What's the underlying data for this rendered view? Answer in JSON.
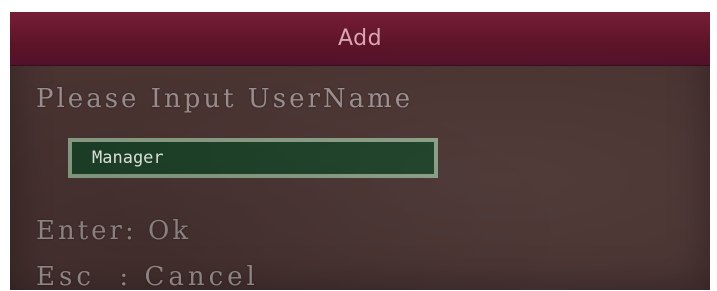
{
  "dialog": {
    "title": "Add",
    "prompt": "Please Input UserName",
    "username_value": "Manager",
    "enter_hint": "Enter: Ok",
    "esc_hint": "Esc  : Cancel"
  },
  "colors": {
    "title_bar": "#5e1428",
    "background": "#4a3432",
    "input_fill": "#1d4128",
    "input_border": "#8aa085",
    "text": "#9a8f8e"
  }
}
